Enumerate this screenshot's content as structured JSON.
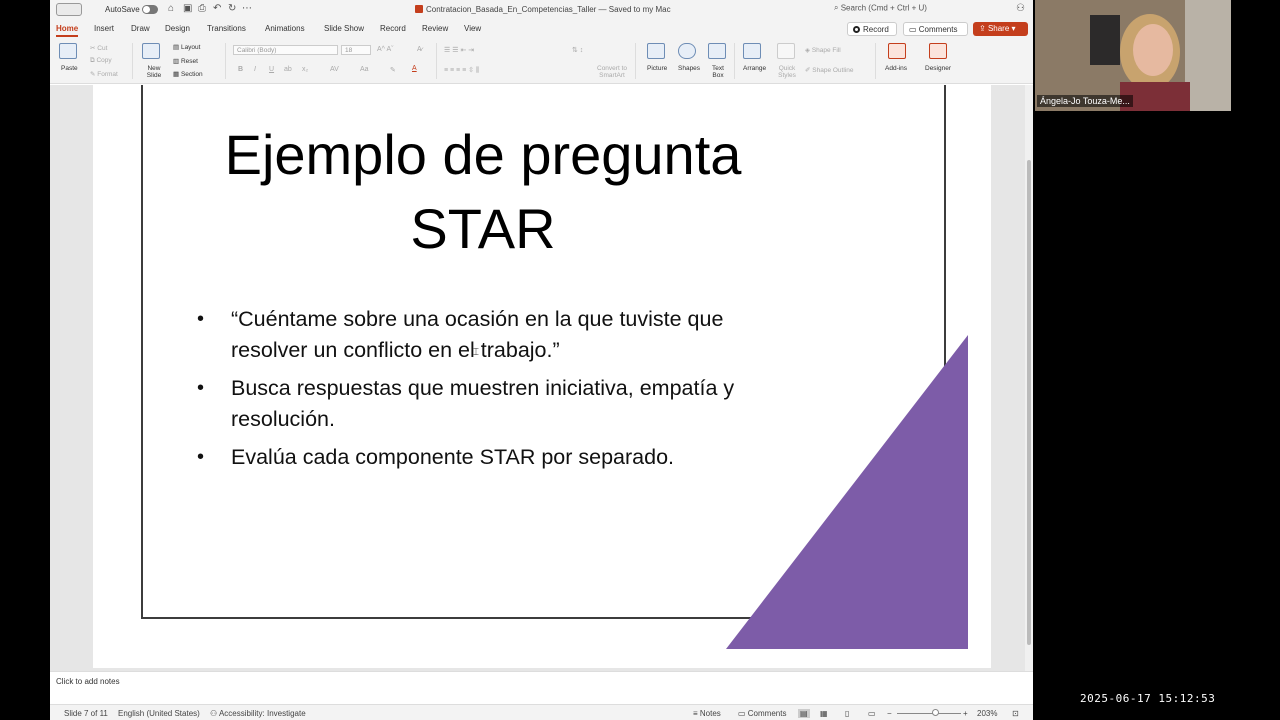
{
  "titlebar": {
    "autosave_label": "AutoSave",
    "doc_title": "Contratacion_Basada_En_Competencias_Taller — Saved to my Mac",
    "search_placeholder": "Search (Cmd + Ctrl + U)"
  },
  "ribbon_tabs": [
    {
      "label": "Home",
      "active": true
    },
    {
      "label": "Insert"
    },
    {
      "label": "Draw"
    },
    {
      "label": "Design"
    },
    {
      "label": "Transitions"
    },
    {
      "label": "Animations"
    },
    {
      "label": "Slide Show"
    },
    {
      "label": "Record"
    },
    {
      "label": "Review"
    },
    {
      "label": "View"
    }
  ],
  "ribbon_actions": {
    "record": "Record",
    "comments": "Comments",
    "share": "Share"
  },
  "ribbon": {
    "paste": "Paste",
    "cut": "Cut",
    "copy": "Copy",
    "format": "Format",
    "new_slide": "New Slide",
    "layout": "Layout",
    "reset": "Reset",
    "section": "Section",
    "font_name": "Calibri (Body)",
    "font_size": "18",
    "convert_smartart": "Convert to SmartArt",
    "picture": "Picture",
    "shapes": "Shapes",
    "text_box": "Text Box",
    "arrange": "Arrange",
    "quick_styles": "Quick Styles",
    "shape_fill": "Shape Fill",
    "shape_outline": "Shape Outline",
    "add_ins": "Add-ins",
    "designer": "Designer"
  },
  "slide": {
    "title": "Ejemplo de pregunta STAR",
    "bullets": [
      "“Cuéntame sobre una ocasión en la que tuviste que resolver un conflicto en el trabajo.”",
      "Busca respuestas que muestren iniciativa, empatía y resolución.",
      "Evalúa cada componente STAR por separado."
    ],
    "accent_color": "#7d5ca8"
  },
  "notes": {
    "placeholder": "Click to add notes"
  },
  "statusbar": {
    "slide_position": "Slide 7 of 11",
    "language": "English (United States)",
    "accessibility": "Accessibility: Investigate",
    "notes": "Notes",
    "comments": "Comments",
    "zoom": "203%"
  },
  "video": {
    "participant_name": "Ángela-Jo Touza-Me..."
  },
  "timestamp": "2025-06-17  15:12:53",
  "colors": {
    "brand": "#c43e1c"
  }
}
